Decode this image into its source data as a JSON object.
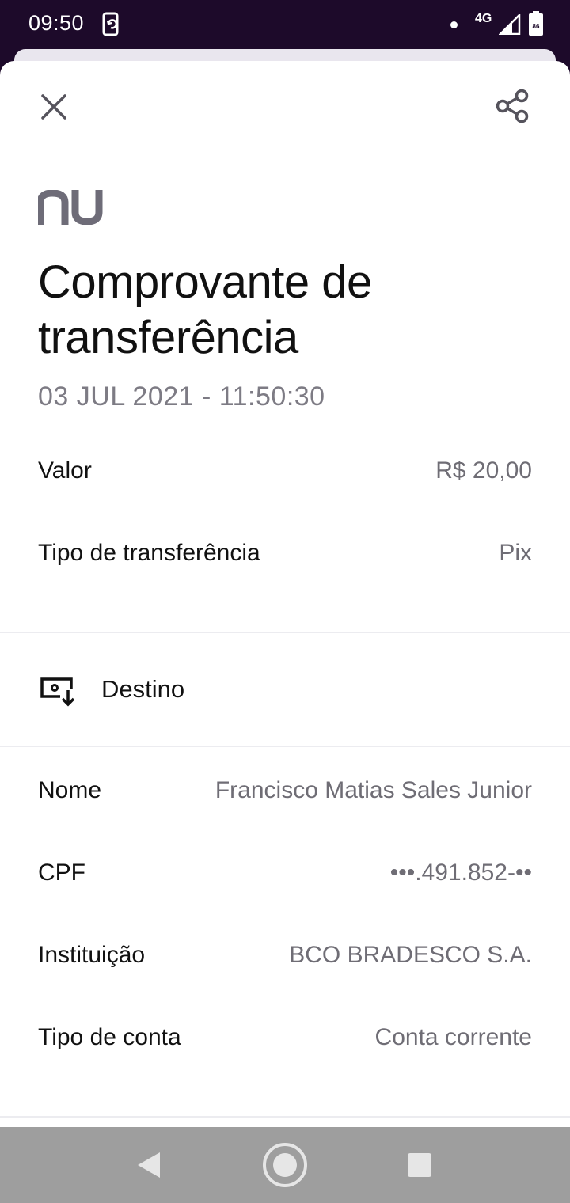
{
  "status_bar": {
    "time": "09:50",
    "network": "4G",
    "battery_level": "86"
  },
  "header": {
    "close_icon": "close-icon",
    "share_icon": "share-icon"
  },
  "brand": {
    "logo": "nu"
  },
  "receipt": {
    "title": "Comprovante de transferência",
    "datetime": "03 JUL 2021 - 11:50:30",
    "summary": [
      {
        "label": "Valor",
        "value": "R$ 20,00"
      },
      {
        "label": "Tipo de transferência",
        "value": "Pix"
      }
    ],
    "destination": {
      "section_label": "Destino",
      "fields": [
        {
          "label": "Nome",
          "value": "Francisco Matias Sales Junior"
        },
        {
          "label": "CPF",
          "value": "•••.491.852-••"
        },
        {
          "label": "Instituição",
          "value": "BCO BRADESCO S.A."
        },
        {
          "label": "Tipo de conta",
          "value": "Conta corrente"
        }
      ]
    }
  },
  "colors": {
    "status_bar_bg": "#1d0a2a",
    "primary_text": "#111111",
    "secondary_text": "#6f6d75",
    "logo": "#6e6c78",
    "nav_bar_bg": "#9e9e9e"
  }
}
